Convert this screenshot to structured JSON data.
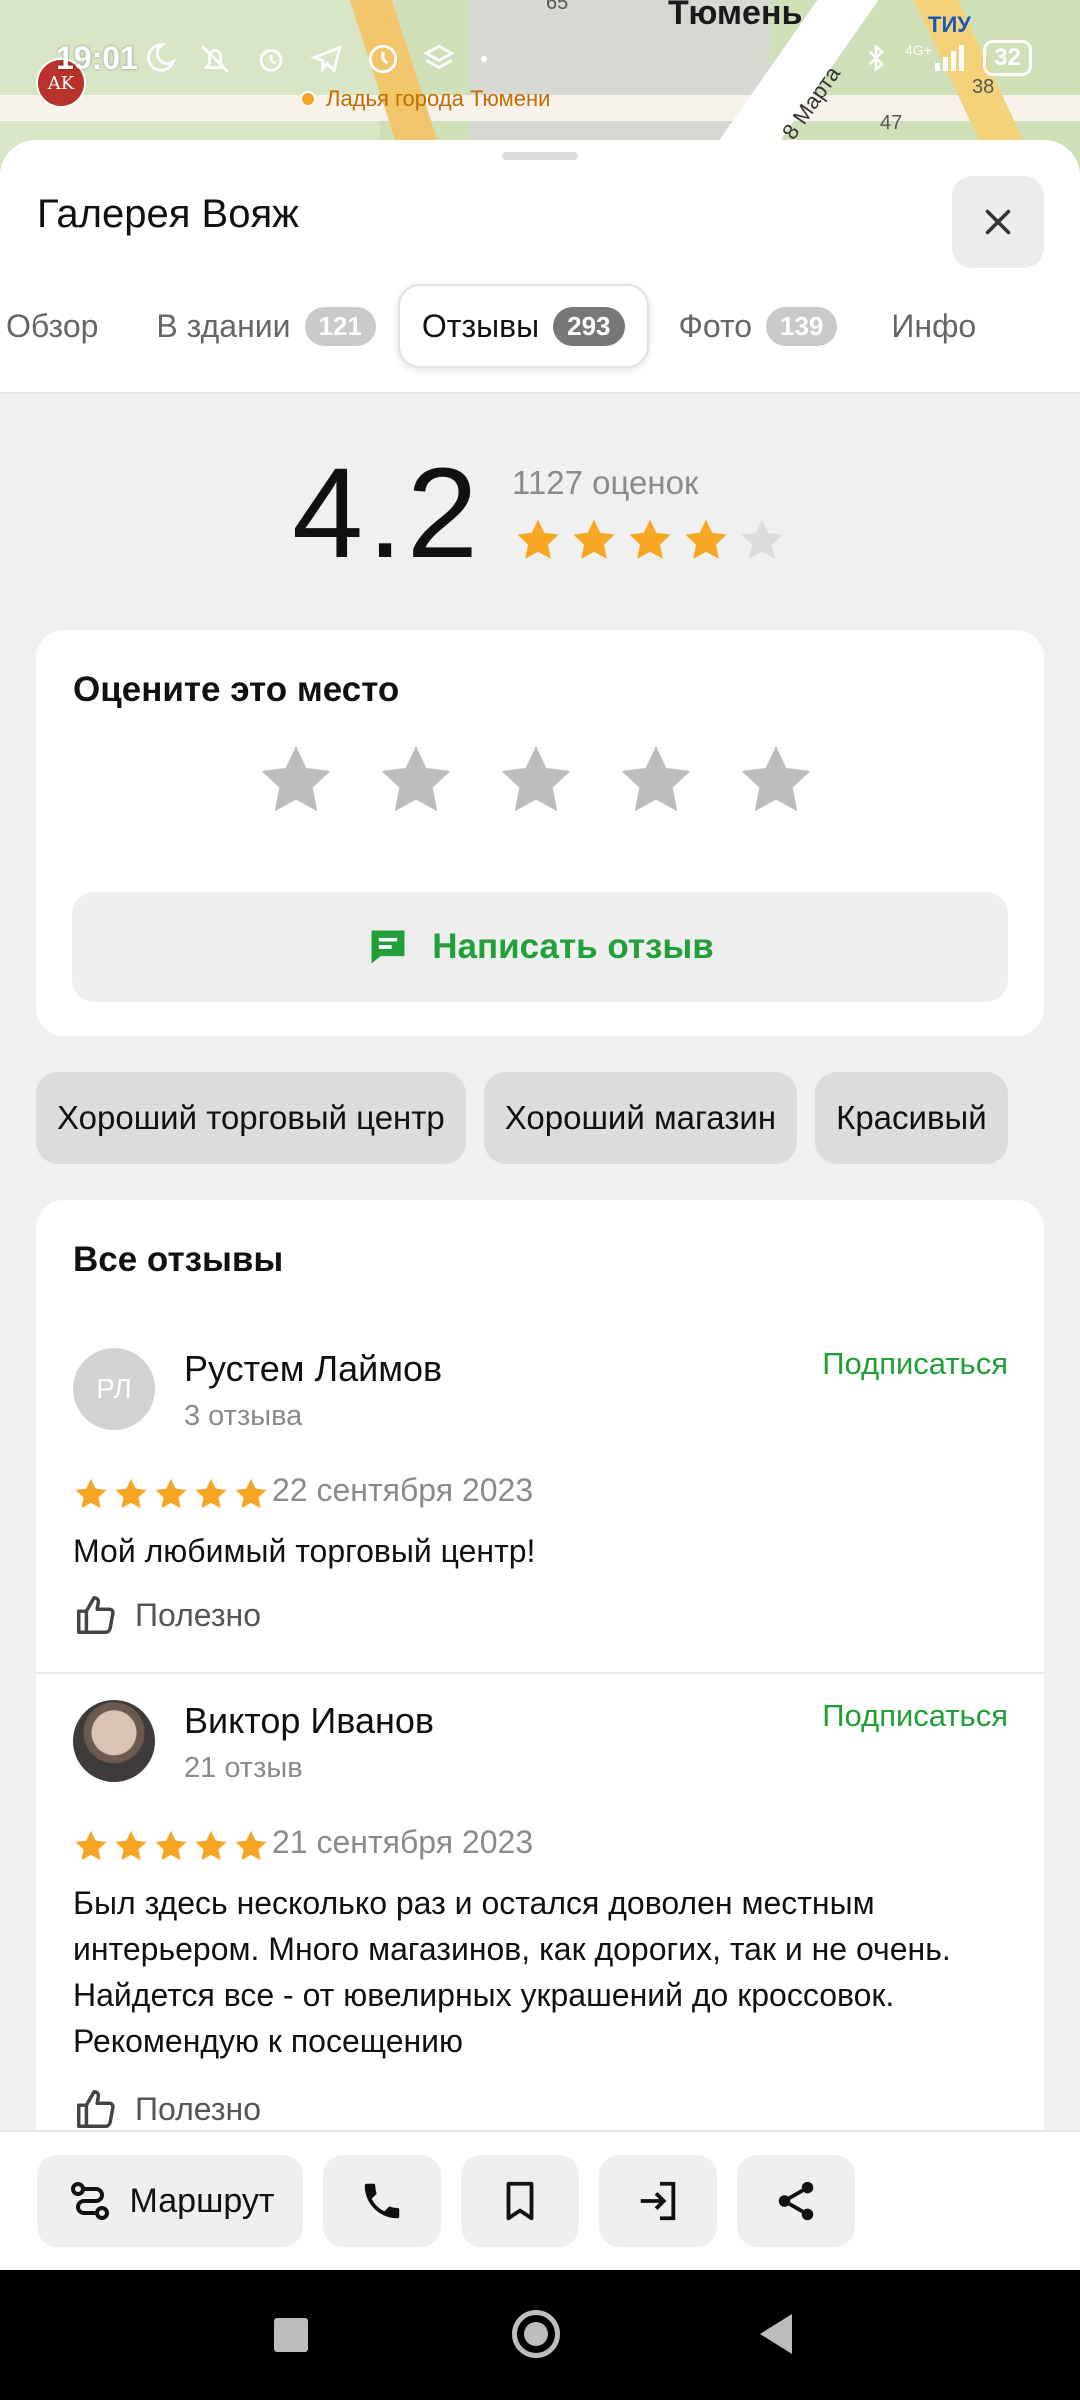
{
  "status_bar": {
    "time": "19:01",
    "network": "4G+",
    "battery": "32",
    "app_avatar_initials": "AK"
  },
  "map": {
    "city": "Тюмень",
    "place": "Ладья города Тюмени",
    "street": "8 Марта",
    "poi": "ТИУ",
    "numbers": [
      "65",
      "47",
      "38"
    ]
  },
  "sheet": {
    "title": "Галерея Вояж",
    "tabs": [
      {
        "label": "Обзор",
        "count": ""
      },
      {
        "label": "В здании",
        "count": "121"
      },
      {
        "label": "Отзывы",
        "count": "293"
      },
      {
        "label": "Фото",
        "count": "139"
      },
      {
        "label": "Инфо",
        "count": ""
      }
    ],
    "active_tab": "Отзывы"
  },
  "rating_summary": {
    "rating": "4.2",
    "ratings_count": "1127 оценок",
    "stars_filled": 4,
    "stars_total": 5
  },
  "rate_card": {
    "title": "Оцените это место",
    "write_review_label": "Написать отзыв"
  },
  "chips": [
    "Хороший торговый центр",
    "Хороший магазин",
    "Красивый"
  ],
  "reviews": {
    "title": "Все отзывы",
    "items": [
      {
        "initials": "РЛ",
        "name": "Рустем Лаймов",
        "count": "3 отзыва",
        "follow": "Подписаться",
        "stars": 5,
        "date": "22 сентября 2023",
        "text": "Мой любимый торговый центр!",
        "useful": "Полезно"
      },
      {
        "initials": "",
        "name": "Виктор Иванов",
        "count": "21 отзыв",
        "follow": "Подписаться",
        "stars": 5,
        "date": "21 сентября 2023",
        "text": "Был здесь несколько раз и остался доволен местным интерьером. Много магазинов, как дорогих, так и не очень. Найдется все - от ювелирных украшений до кроссовок. Рекомендую к посещению",
        "useful": "Полезно"
      }
    ]
  },
  "actions": {
    "route_label": "Маршрут",
    "icons": [
      "route-icon",
      "phone-icon",
      "bookmark-icon",
      "enter-icon",
      "share-icon"
    ]
  },
  "colors": {
    "accent_green": "#21a038",
    "star_gold": "#f5a623",
    "star_grey": "#bdbdbd"
  }
}
